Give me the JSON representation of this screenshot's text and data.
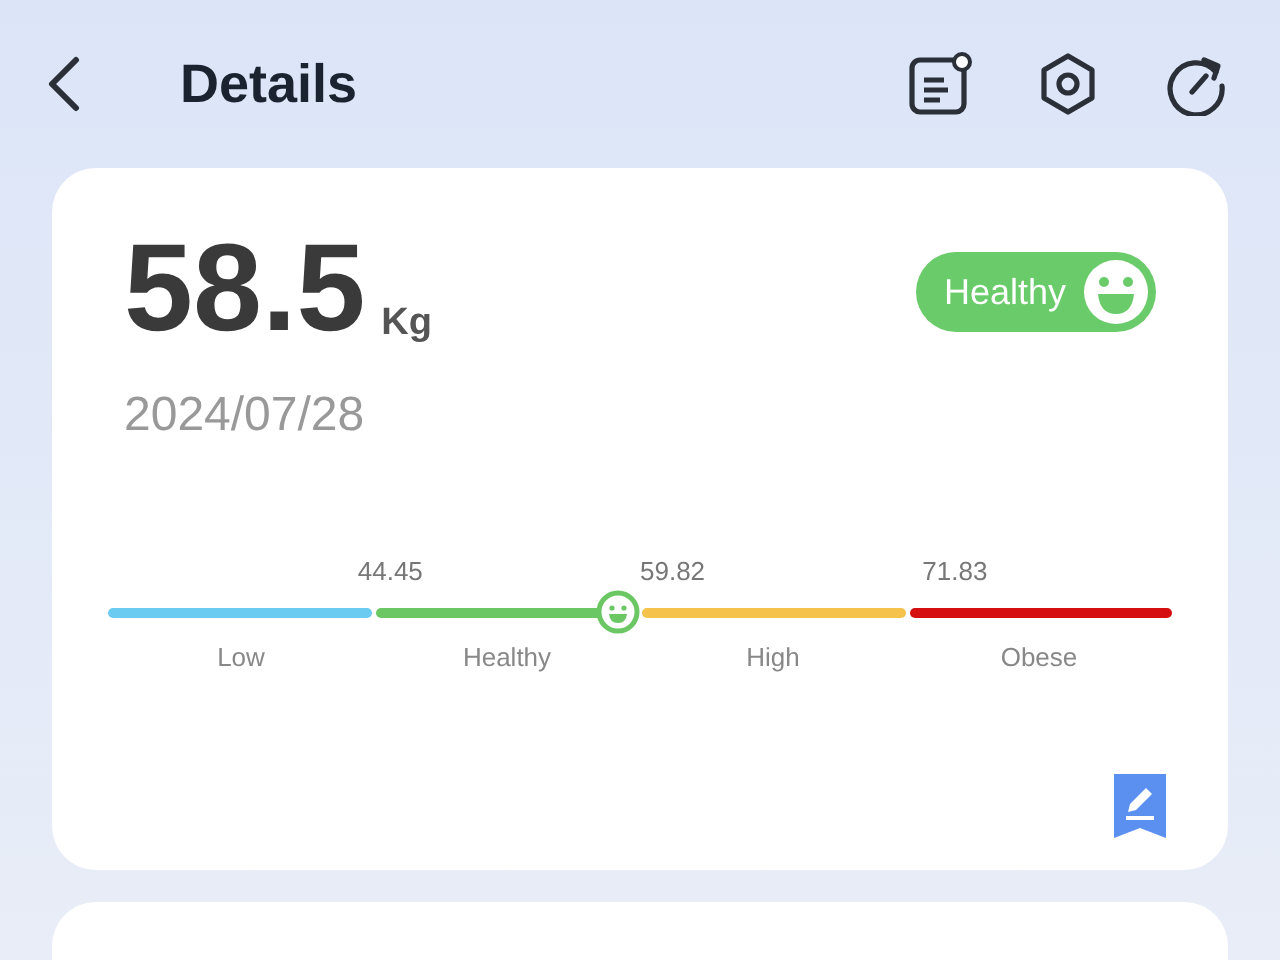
{
  "header": {
    "title": "Details"
  },
  "weight": {
    "value": "58.5",
    "unit": "Kg",
    "date": "2024/07/28",
    "status": "Healthy"
  },
  "scale": {
    "level": 0.48,
    "segments": [
      {
        "label": "Low",
        "color": "#6ccbf0",
        "upper": "44.45"
      },
      {
        "label": "Healthy",
        "color": "#6bc764",
        "upper": "59.82"
      },
      {
        "label": "High",
        "color": "#f5c24c",
        "upper": "71.83"
      },
      {
        "label": "Obese",
        "color": "#d50f0f"
      }
    ]
  }
}
